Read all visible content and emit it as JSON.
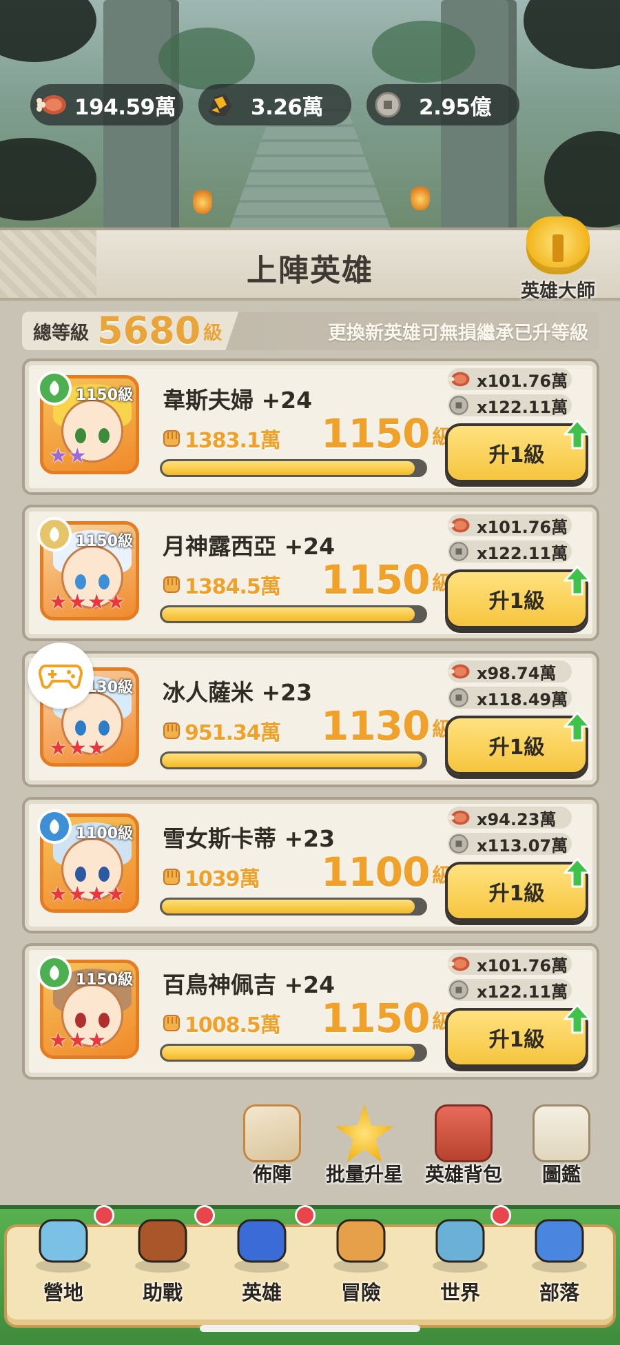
{
  "resources": [
    {
      "icon": "meat-icon",
      "value": "194.59萬"
    },
    {
      "icon": "ore-icon",
      "value": "3.26萬"
    },
    {
      "icon": "coin-icon",
      "value": "2.95億"
    }
  ],
  "panel": {
    "title": "上陣英雄",
    "master_label": "英雄大師",
    "total_label": "總等級",
    "total_value": "5680",
    "total_unit": "級",
    "note": "更換新英雄可無損繼承已升等級"
  },
  "heroes": [
    {
      "name": "韋斯夫婦 +24",
      "portrait_level": "1150級",
      "power": "1383.1萬",
      "level": "1150",
      "level_unit": "級",
      "progress": 0.96,
      "meat_cost": "x101.76萬",
      "coin_cost": "x122.11萬",
      "button": "升1級",
      "element": "nature",
      "stars": 2
    },
    {
      "name": "月神露西亞 +24",
      "portrait_level": "1150級",
      "power": "1384.5萬",
      "level": "1150",
      "level_unit": "級",
      "progress": 0.96,
      "meat_cost": "x101.76萬",
      "coin_cost": "x122.11萬",
      "button": "升1級",
      "element": "light",
      "stars": 4
    },
    {
      "name": "冰人薩米 +23",
      "portrait_level": "1130級",
      "power": "951.34萬",
      "level": "1130",
      "level_unit": "級",
      "progress": 0.99,
      "meat_cost": "x98.74萬",
      "coin_cost": "x118.49萬",
      "button": "升1級",
      "element": "water",
      "stars": 3
    },
    {
      "name": "雪女斯卡蒂 +23",
      "portrait_level": "1100級",
      "power": "1039萬",
      "level": "1100",
      "level_unit": "級",
      "progress": 0.96,
      "meat_cost": "x94.23萬",
      "coin_cost": "x113.07萬",
      "button": "升1級",
      "element": "water",
      "stars": 4
    },
    {
      "name": "百鳥神佩吉 +24",
      "portrait_level": "1150級",
      "power": "1008.5萬",
      "level": "1150",
      "level_unit": "級",
      "progress": 0.96,
      "meat_cost": "x101.76萬",
      "coin_cost": "x122.11萬",
      "button": "升1級",
      "element": "nature",
      "stars": 3
    }
  ],
  "actions": [
    {
      "label": "佈陣",
      "icon": "formation-icon"
    },
    {
      "label": "批量升星",
      "icon": "star-upgrade-icon"
    },
    {
      "label": "英雄背包",
      "icon": "hero-bag-icon"
    },
    {
      "label": "圖鑑",
      "icon": "collection-icon"
    }
  ],
  "nav": [
    {
      "label": "營地",
      "icon": "camp-goal-icon"
    },
    {
      "label": "助戰",
      "icon": "glove-icon"
    },
    {
      "label": "英雄",
      "icon": "helmet-icon"
    },
    {
      "label": "冒險",
      "icon": "bat-icon"
    },
    {
      "label": "世界",
      "icon": "map-icon"
    },
    {
      "label": "部落",
      "icon": "tribe-icon"
    }
  ],
  "colors": {
    "accent": "#f0a12a",
    "button": "#f6c53f",
    "badge": "#e8454d"
  }
}
